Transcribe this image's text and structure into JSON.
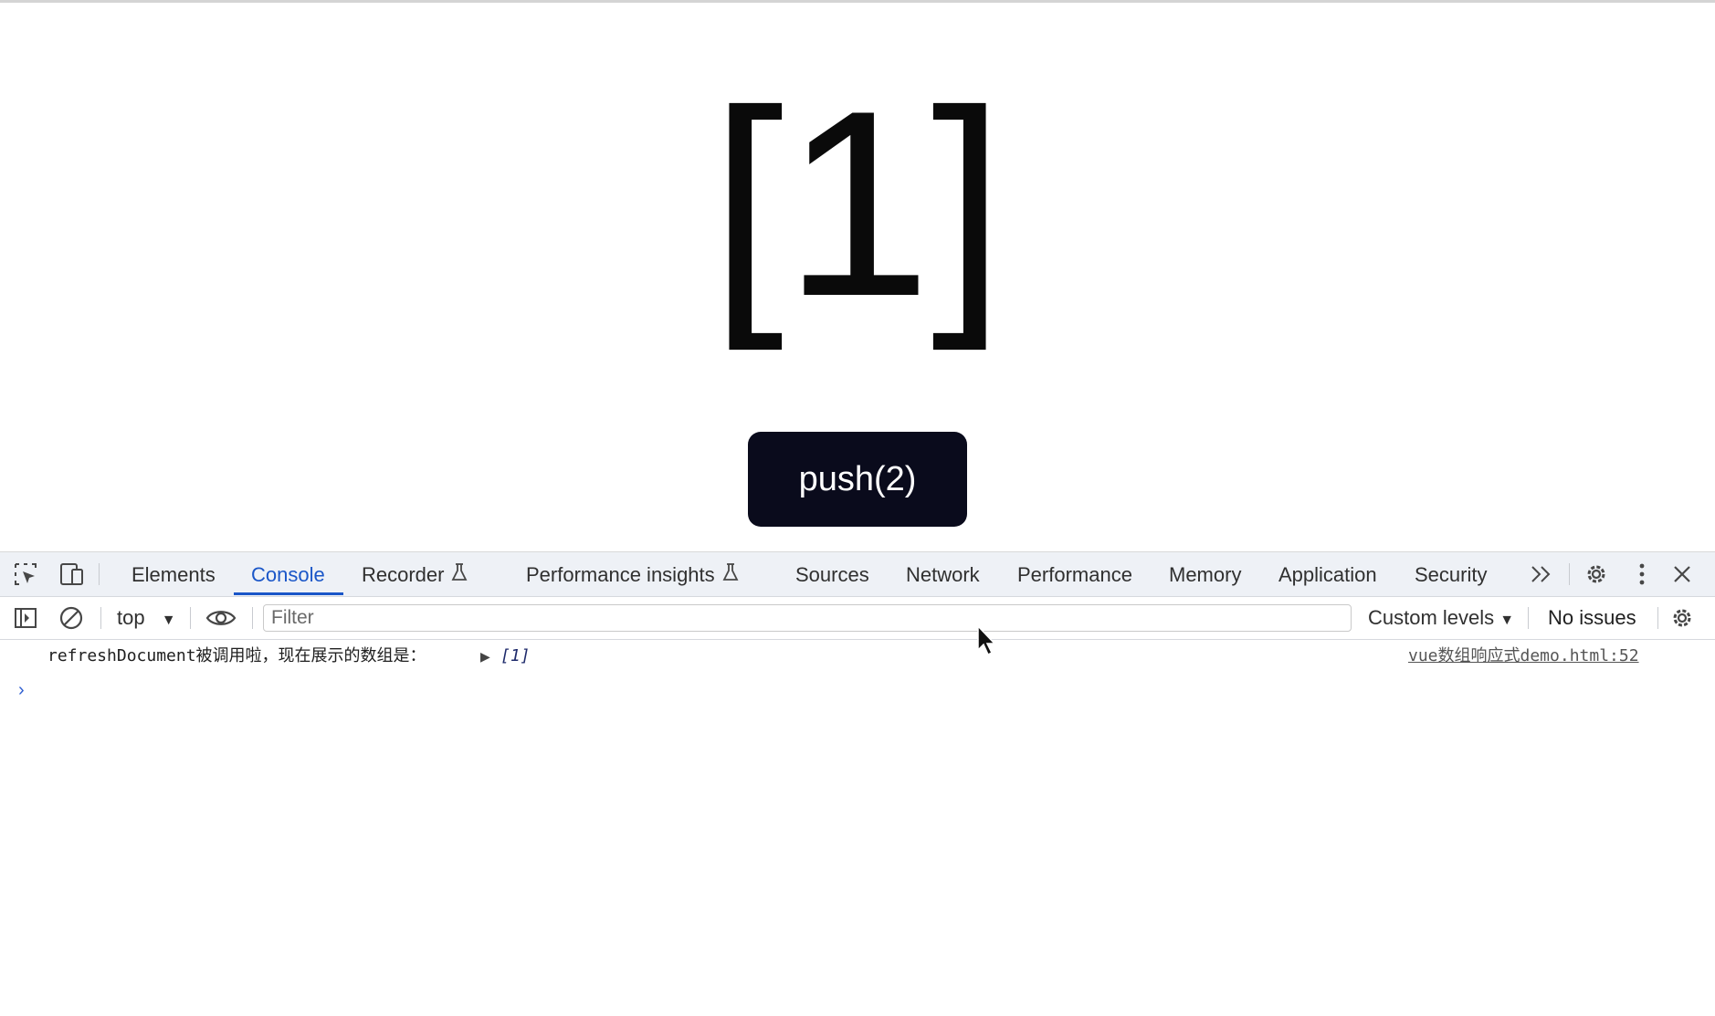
{
  "page": {
    "array_text": "[1]",
    "push_button_label": "push(2)"
  },
  "devtools": {
    "tabs": [
      {
        "label": "Elements",
        "active": false
      },
      {
        "label": "Console",
        "active": true
      },
      {
        "label": "Recorder",
        "active": false,
        "experimental": true
      },
      {
        "label": "Performance insights",
        "active": false,
        "experimental": true
      },
      {
        "label": "Sources",
        "active": false
      },
      {
        "label": "Network",
        "active": false
      },
      {
        "label": "Performance",
        "active": false
      },
      {
        "label": "Memory",
        "active": false
      },
      {
        "label": "Application",
        "active": false
      },
      {
        "label": "Security",
        "active": false
      }
    ],
    "icons": [
      "inspect-element-icon",
      "device-toolbar-icon",
      "more-tabs-icon",
      "settings-gear-icon",
      "kebab-menu-icon",
      "close-icon"
    ],
    "accent_color": "#1a56c8"
  },
  "toolbar": {
    "context": "top",
    "filter_placeholder": "Filter",
    "levels_label": "Custom levels",
    "issues_label": "No issues"
  },
  "console": {
    "log": {
      "message": "refreshDocument被调用啦，现在展示的数组是：",
      "value": "[1]",
      "source": "vue数组响应式demo.html:52"
    }
  }
}
